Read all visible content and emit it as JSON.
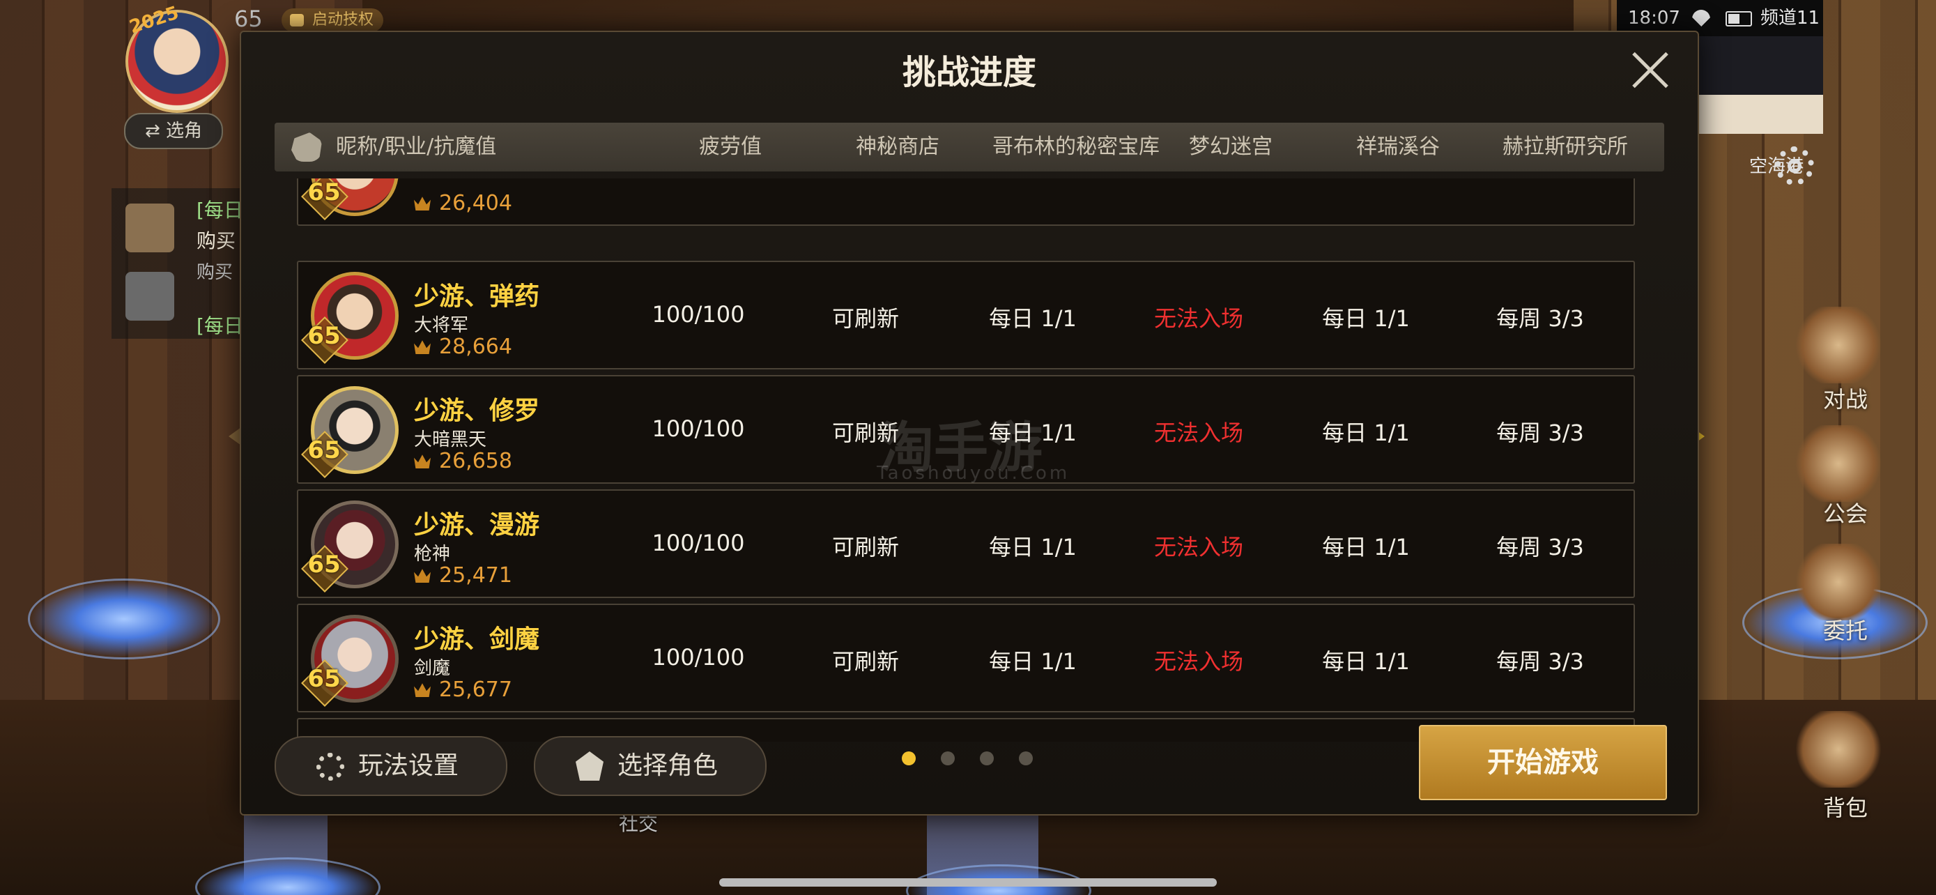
{
  "hud": {
    "year": "2025",
    "level": "65",
    "skill_label": "启动技权",
    "switch_char": "⇄ 选角",
    "quests": [
      "[每日",
      "购买",
      "购买",
      "[每日"
    ],
    "time": "18:07",
    "channel": "频道11",
    "map_name": "空海港",
    "menu": [
      "对战",
      "公会",
      "委托",
      "背包"
    ],
    "bottom": [
      "社交"
    ]
  },
  "modal": {
    "title": "挑战进度",
    "headers": {
      "name": "昵称/职业/抗魔值",
      "fatigue": "疲劳值",
      "shop": "神秘商店",
      "goblin": "哥布林的秘密宝库",
      "maze": "梦幻迷宫",
      "valley": "祥瑞溪谷",
      "lab": "赫拉斯研究所"
    },
    "partial_row": {
      "level": "65",
      "power": "26,404"
    },
    "rows": [
      {
        "level": "65",
        "name": "少游、弹药",
        "job": "大将军",
        "power": "28,664",
        "fatigue": "100/100",
        "shop": "可刷新",
        "goblin": "每日 1/1",
        "maze": "无法入场",
        "valley": "每日 1/1",
        "lab": "每周 3/3"
      },
      {
        "level": "65",
        "name": "少游、修罗",
        "job": "大暗黑天",
        "power": "26,658",
        "fatigue": "100/100",
        "shop": "可刷新",
        "goblin": "每日 1/1",
        "maze": "无法入场",
        "valley": "每日 1/1",
        "lab": "每周 3/3"
      },
      {
        "level": "65",
        "name": "少游、漫游",
        "job": "枪神",
        "power": "25,471",
        "fatigue": "100/100",
        "shop": "可刷新",
        "goblin": "每日 1/1",
        "maze": "无法入场",
        "valley": "每日 1/1",
        "lab": "每周 3/3"
      },
      {
        "level": "65",
        "name": "少游、剑魔",
        "job": "剑魔",
        "power": "25,677",
        "fatigue": "100/100",
        "shop": "可刷新",
        "goblin": "每日 1/1",
        "maze": "无法入场",
        "valley": "每日 1/1",
        "lab": "每周 3/3"
      }
    ],
    "footer": {
      "settings": "玩法设置",
      "select_role": "选择角色",
      "start": "开始游戏"
    },
    "pagination": {
      "pages": 4,
      "current": 1
    }
  },
  "watermark": {
    "main": "淘手游",
    "sub": "Taoshouyou.Com"
  },
  "colors": {
    "accent": "#f3c12e",
    "name": "#ffd242",
    "warn": "#f03030",
    "power": "#e8a03a"
  },
  "icons": [
    "settings-gear-icon",
    "role-select-icon",
    "close-icon",
    "power-icon",
    "wifi-icon",
    "battery-icon"
  ]
}
